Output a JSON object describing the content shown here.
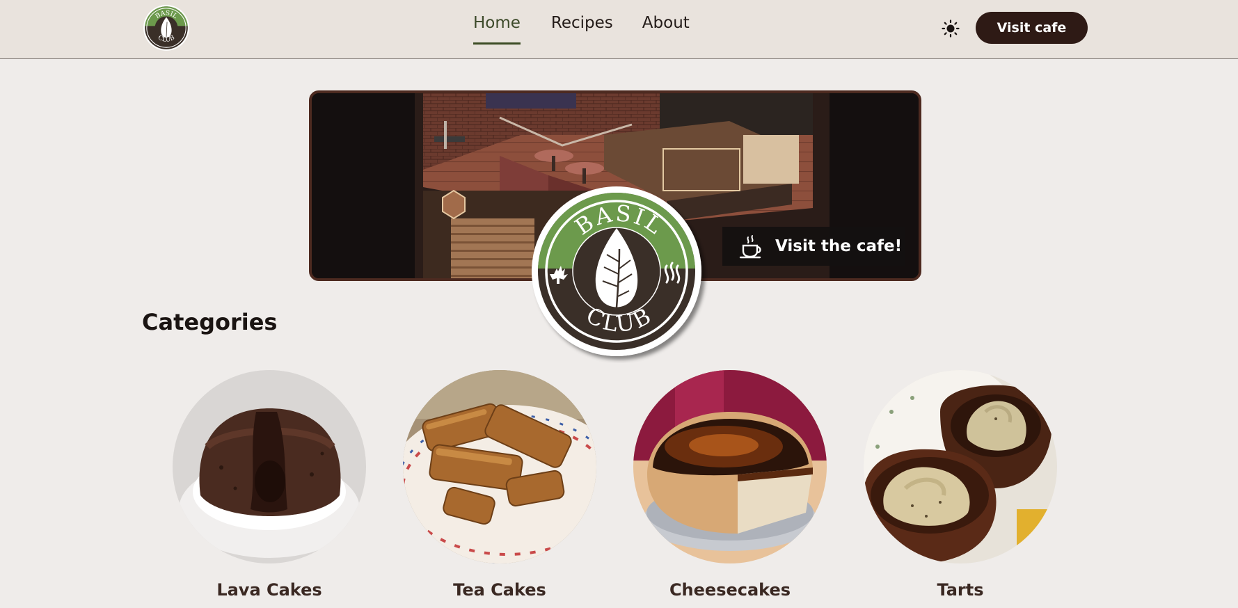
{
  "header": {
    "logo_top": "BASIL",
    "logo_bottom": "CLUB",
    "nav": [
      {
        "label": "Home",
        "active": true
      },
      {
        "label": "Recipes",
        "active": false
      },
      {
        "label": "About",
        "active": false
      }
    ],
    "theme_icon": "sun-icon",
    "visit_button": "Visit cafe"
  },
  "hero": {
    "cta_label": "Visit the cafe!",
    "cta_icon": "coffee-cup-icon",
    "logo_top": "BASIL",
    "logo_bottom": "CLUB"
  },
  "categories": {
    "title": "Categories",
    "items": [
      {
        "label": "Lava Cakes"
      },
      {
        "label": "Tea Cakes"
      },
      {
        "label": "Cheesecakes"
      },
      {
        "label": "Tarts"
      }
    ]
  },
  "colors": {
    "accent_dark": "#2e1a15",
    "brand_green": "#6c9a4c",
    "brand_brown": "#3a2f28",
    "page_bg": "#efecea",
    "header_bg": "#e9e3dd"
  }
}
